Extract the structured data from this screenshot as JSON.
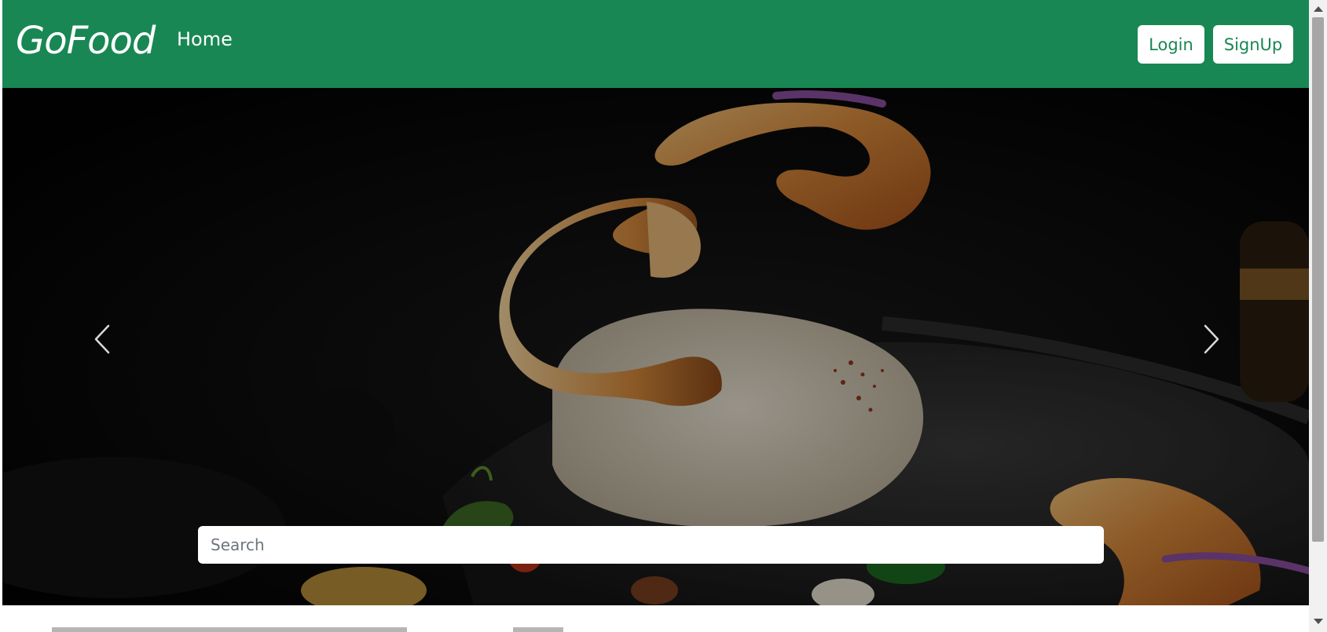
{
  "navbar": {
    "brand": "GoFood",
    "home_link": "Home",
    "login_label": "Login",
    "signup_label": "SignUp",
    "background_color": "#198754"
  },
  "hero": {
    "prev_icon": "chevron-left-icon",
    "next_icon": "chevron-right-icon"
  },
  "search": {
    "placeholder": "Search",
    "value": ""
  }
}
